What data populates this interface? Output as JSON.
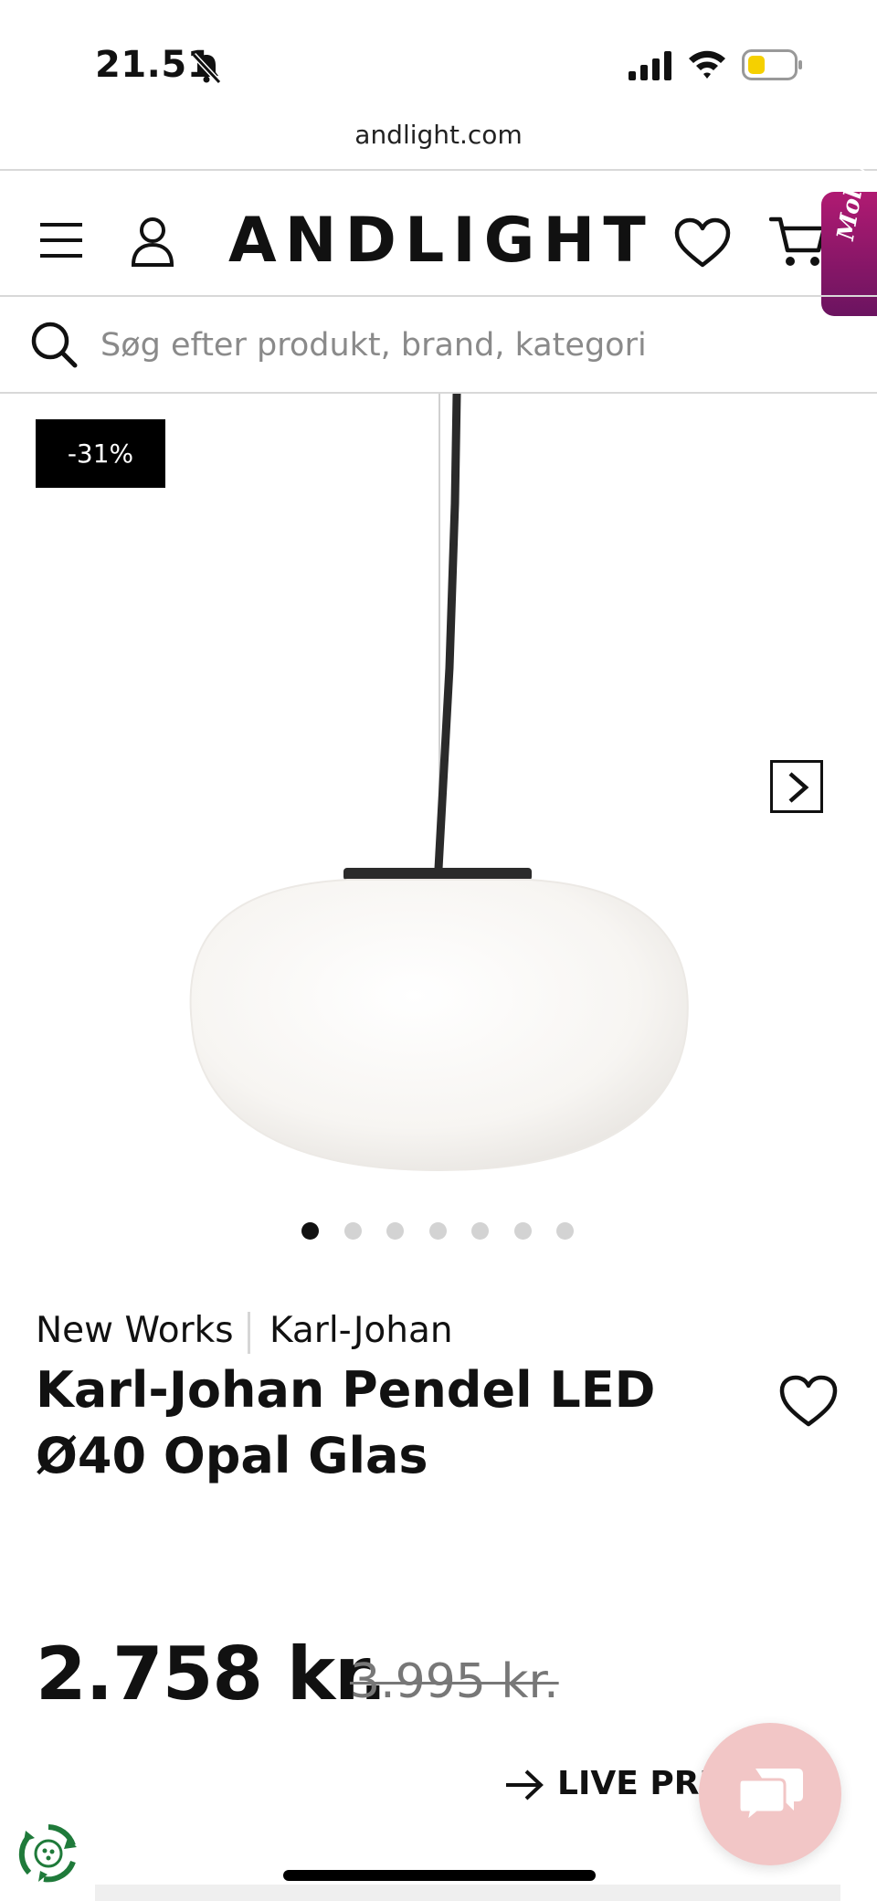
{
  "status_bar": {
    "time": "21.51",
    "icons": [
      "bell-slash-icon",
      "signal-icon",
      "wifi-icon",
      "battery-icon"
    ],
    "battery_color": "#f5d000"
  },
  "browser": {
    "url": "andlight.com"
  },
  "header": {
    "logo": "ANDLIGHT",
    "molly_label": "Molly",
    "molly_color": "#9c1a6e",
    "icons": [
      "menu-icon",
      "account-icon",
      "heart-icon",
      "cart-icon"
    ]
  },
  "search": {
    "placeholder": "Søg efter produkt, brand, kategori",
    "value": ""
  },
  "product": {
    "discount_badge": "-31%",
    "image_alt": "pendant-lamp-image",
    "carousel": {
      "total": 7,
      "active_index": 0
    },
    "brand": "New Works",
    "collection": "Karl-Johan",
    "title_line1": "Karl-Johan Pendel LED",
    "title_line2": "Ø40 Opal Glas",
    "price": "2.758 kr.",
    "old_price": "3.995 kr.",
    "live_price_label": "LIVE PRIS"
  },
  "widgets": {
    "chat_button_color": "#f2c6c6",
    "chat_icon": "chat-bubbles-icon",
    "recycle_icon": "recycle-icon"
  }
}
